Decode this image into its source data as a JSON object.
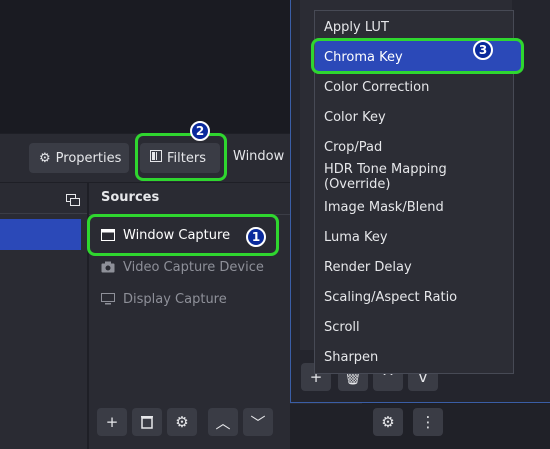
{
  "toolbar": {
    "properties_label": "Properties",
    "filters_label": "Filters",
    "window_label": "Window"
  },
  "sources": {
    "header": "Sources",
    "items": [
      {
        "label": "Window Capture",
        "icon": "window-icon",
        "selected": true
      },
      {
        "label": "Video Capture Device",
        "icon": "camera-icon",
        "selected": false
      },
      {
        "label": "Display Capture",
        "icon": "monitor-icon",
        "selected": false
      }
    ]
  },
  "filter_menu": {
    "items": [
      "Apply LUT",
      "Chroma Key",
      "Color Correction",
      "Color Key",
      "Crop/Pad",
      "HDR Tone Mapping (Override)",
      "Image Mask/Blend",
      "Luma Key",
      "Render Delay",
      "Scaling/Aspect Ratio",
      "Scroll",
      "Sharpen"
    ],
    "selected": "Chroma Key"
  },
  "badges": {
    "one": "1",
    "two": "2",
    "three": "3"
  },
  "colors": {
    "highlight_green": "#2fd62f",
    "selection_blue": "#2b49b8",
    "badge_blue": "#0a2a9c"
  }
}
